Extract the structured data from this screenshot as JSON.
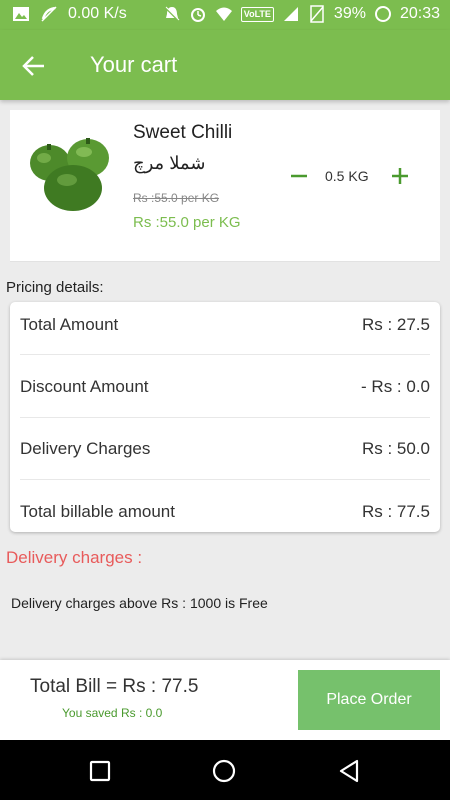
{
  "status_bar": {
    "speed": "0.00 K/s",
    "volte": "VoLTE",
    "battery": "39%",
    "time": "20:33"
  },
  "app_bar": {
    "title": "Your cart",
    "back_icon": "arrow-back-icon"
  },
  "cart_item": {
    "name": "Sweet Chilli",
    "name_urdu": "شملا مرچ",
    "old_price": "Rs :55.0 per KG",
    "new_price": "Rs :55.0 per KG",
    "quantity": "0.5 KG",
    "image": "green-capsicum-image"
  },
  "pricing": {
    "heading": "Pricing details:",
    "rows": [
      {
        "label": "Total Amount",
        "value": "Rs : 27.5"
      },
      {
        "label": "Discount Amount",
        "value": "- Rs : 0.0"
      },
      {
        "label": "Delivery Charges",
        "value": "Rs : 50.0"
      },
      {
        "label": "Total billable amount",
        "value": "Rs : 77.5"
      }
    ]
  },
  "delivery": {
    "heading": "Delivery charges :",
    "note": "Delivery charges above Rs : 1000 is Free"
  },
  "footer": {
    "total_bill": "Total Bill = Rs : 77.5",
    "saved": "You saved Rs : 0.0",
    "place_order_label": "Place Order"
  },
  "colors": {
    "primary": "#7cbd4f",
    "button": "#76c16c",
    "accent_red": "#e85b5b"
  }
}
